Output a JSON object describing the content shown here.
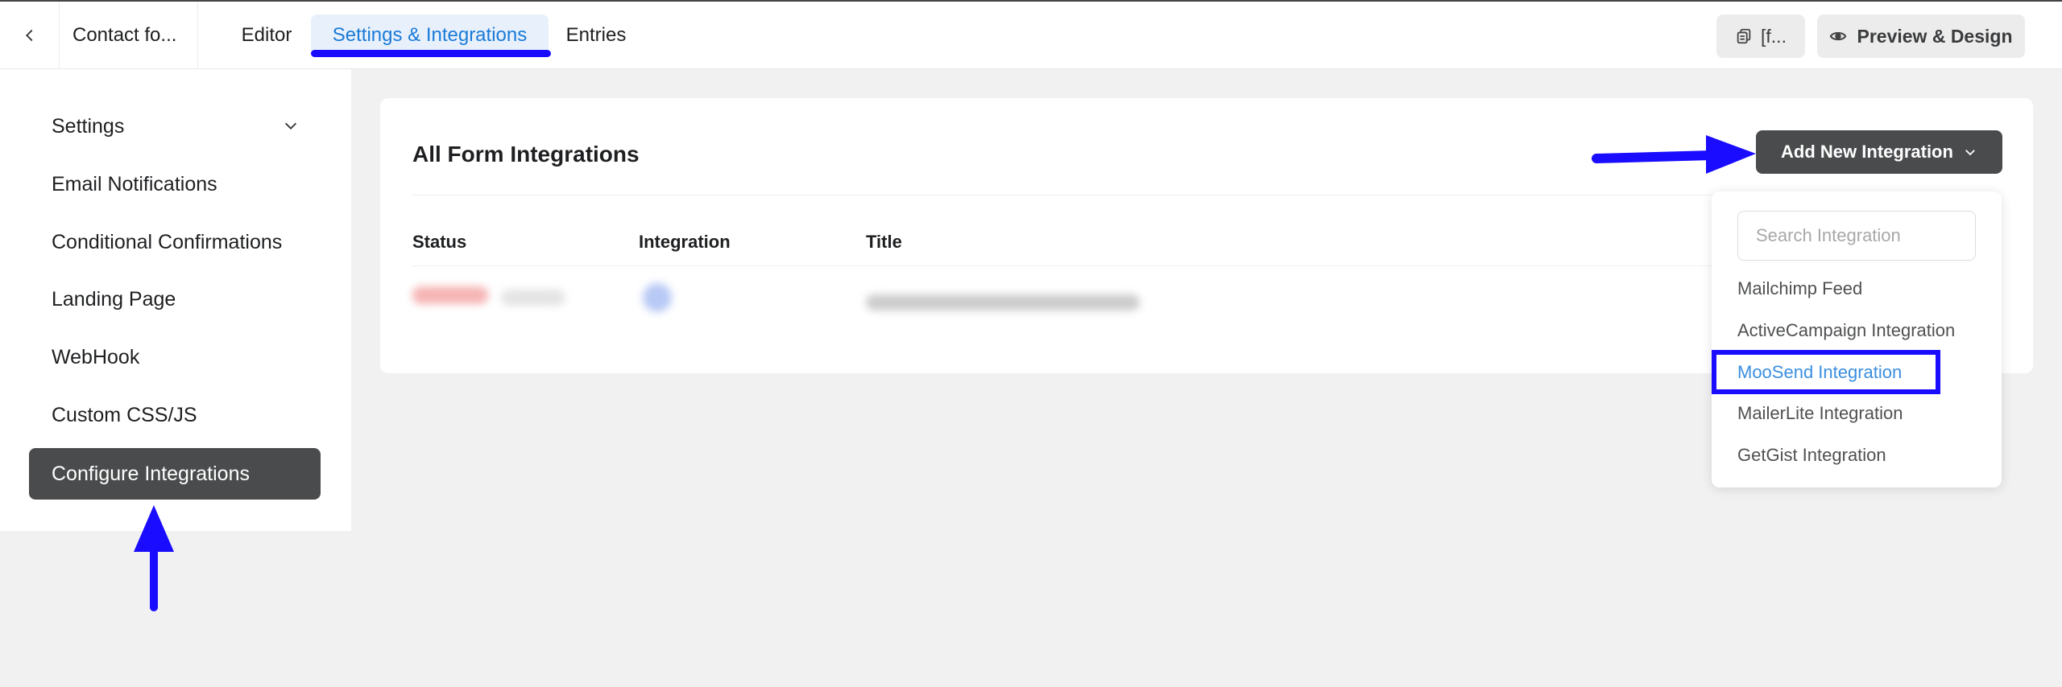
{
  "topbar": {
    "form_title": "Contact fo...",
    "tabs": [
      {
        "label": "Editor"
      },
      {
        "label": "Settings & Integrations",
        "active": true
      },
      {
        "label": "Entries"
      }
    ],
    "shortcode_label": "[f...",
    "preview_label": "Preview & Design"
  },
  "sidebar": {
    "items": [
      {
        "label": "Settings"
      },
      {
        "label": "Email Notifications"
      },
      {
        "label": "Conditional Confirmations"
      },
      {
        "label": "Landing Page"
      },
      {
        "label": "WebHook"
      },
      {
        "label": "Custom CSS/JS"
      },
      {
        "label": "Configure Integrations",
        "active": true
      }
    ]
  },
  "main": {
    "title": "All Form Integrations",
    "add_button_label": "Add New Integration",
    "columns": [
      "Status",
      "Integration",
      "Title"
    ]
  },
  "dropdown": {
    "search_placeholder": "Search Integration",
    "items": [
      {
        "label": "Mailchimp Feed"
      },
      {
        "label": "ActiveCampaign Integration"
      },
      {
        "label": "MooSend Integration",
        "highlighted": true
      },
      {
        "label": "MailerLite Integration"
      },
      {
        "label": "GetGist Integration"
      }
    ]
  },
  "colors": {
    "accent_blue": "#1a7ad8",
    "annotation_blue": "#1a0dff",
    "dark_button": "#4a4b4c",
    "link_highlight": "#3a8ee0"
  }
}
